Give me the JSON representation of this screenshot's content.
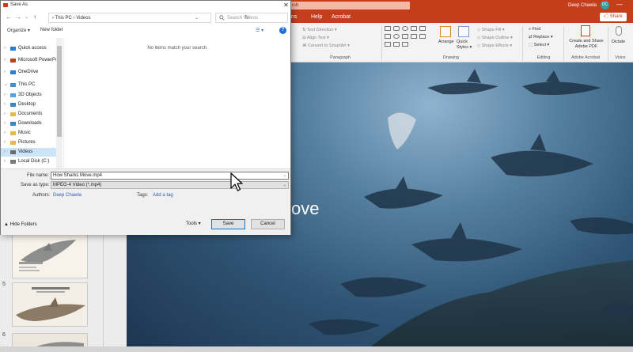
{
  "colors": {
    "ppt_accent": "#c43e1c",
    "dialog_bg": "#ffffff",
    "link_blue": "#1e5fbf",
    "selection": "#cce4f7"
  },
  "dialog": {
    "title": "Save As",
    "close_glyph": "✕",
    "nav": {
      "back_glyph": "←",
      "forward_glyph": "→",
      "recent_glyph": "⌄",
      "up_glyph": "↑",
      "breadcrumb": "› This PC › Videos",
      "chevron_glyph": "⌄",
      "refresh_glyph": "↻",
      "search_placeholder": "Search Videos"
    },
    "toolbar": {
      "organize": "Organize ▾",
      "new_folder": "New folder",
      "view": "☰ ▾",
      "help": "?"
    },
    "tree": [
      {
        "label": "Quick access",
        "icon": "star-icon",
        "expander": "›",
        "color": "#2b7cd3"
      },
      {
        "label": "Microsoft PowerPo",
        "icon": "powerpoint-icon",
        "expander": "›",
        "color": "#c43e1c"
      },
      {
        "label": "OneDrive",
        "icon": "cloud-icon",
        "expander": "›",
        "color": "#2b7cd3"
      },
      {
        "label": "This PC",
        "icon": "pc-icon",
        "expander": "⌄",
        "color": "#4a90c8"
      },
      {
        "label": "3D Objects",
        "icon": "cube-icon",
        "expander": "›",
        "color": "#5aa0d8"
      },
      {
        "label": "Desktop",
        "icon": "desktop-icon",
        "expander": "›",
        "color": "#3a84c8"
      },
      {
        "label": "Documents",
        "icon": "document-folder-icon",
        "expander": "›",
        "color": "#e6b84a"
      },
      {
        "label": "Downloads",
        "icon": "download-folder-icon",
        "expander": "›",
        "color": "#3a84c8"
      },
      {
        "label": "Music",
        "icon": "music-icon",
        "expander": "›",
        "color": "#e6b84a"
      },
      {
        "label": "Pictures",
        "icon": "pictures-icon",
        "expander": "›",
        "color": "#e6b84a"
      },
      {
        "label": "Videos",
        "icon": "video-folder-icon",
        "expander": "›",
        "color": "#6a6a6a",
        "selected": true
      },
      {
        "label": "Local Disk (C:)",
        "icon": "disk-icon",
        "expander": "›",
        "color": "#7a7a7a"
      }
    ],
    "empty_message": "No items match your search.",
    "fields": {
      "filename_label": "File name:",
      "filename_value": "How Sharks Move.mp4",
      "filetype_label": "Save as type:",
      "filetype_value": "MPEG-4 Video (*.mp4)",
      "authors_label": "Authors:",
      "authors_value": "Deep Chawla",
      "tags_label": "Tags:",
      "tags_value": "Add a tag",
      "dropdown_glyph": "⌄"
    },
    "footer": {
      "hide_folders": "▲ Hide Folders",
      "tools": "Tools ▾",
      "save": "Save",
      "cancel": "Cancel"
    }
  },
  "ppt": {
    "search_text": "rch",
    "user_name": "Deep Chawla",
    "user_initials": "DC",
    "minimize_glyph": "—",
    "tabs": [
      "ns",
      "Help",
      "Acrobat"
    ],
    "share": "🖒 Share",
    "ribbon": {
      "text_direction": "⇅ Text Direction ▾",
      "align_text": "⊟ Align Text ▾",
      "convert_smartart": "⌘ Convert to SmartArt ▾",
      "arrange": "Arrange",
      "quick_styles": "Quick Styles ▾",
      "shape_fill": "◇ Shape Fill ▾",
      "shape_outline": "◇ Shape Outline ▾",
      "shape_effects": "◇ Shape Effects ▾",
      "find": "⌕ Find",
      "replace": "⇄ Replace ▾",
      "select": "⬚ Select ▾",
      "create_share": "Create and Share Adobe PDF",
      "dictate": "Dictate",
      "groups": {
        "paragraph": "Paragraph",
        "drawing": "Drawing",
        "editing": "Editing",
        "adobe": "Adobe Acrobat",
        "voice": "Voice"
      }
    },
    "slides": [
      {
        "number": "",
        "title": ""
      },
      {
        "number": "5",
        "title": ""
      },
      {
        "number": "6",
        "title": ""
      }
    ],
    "slide_title_visible": "ove"
  }
}
